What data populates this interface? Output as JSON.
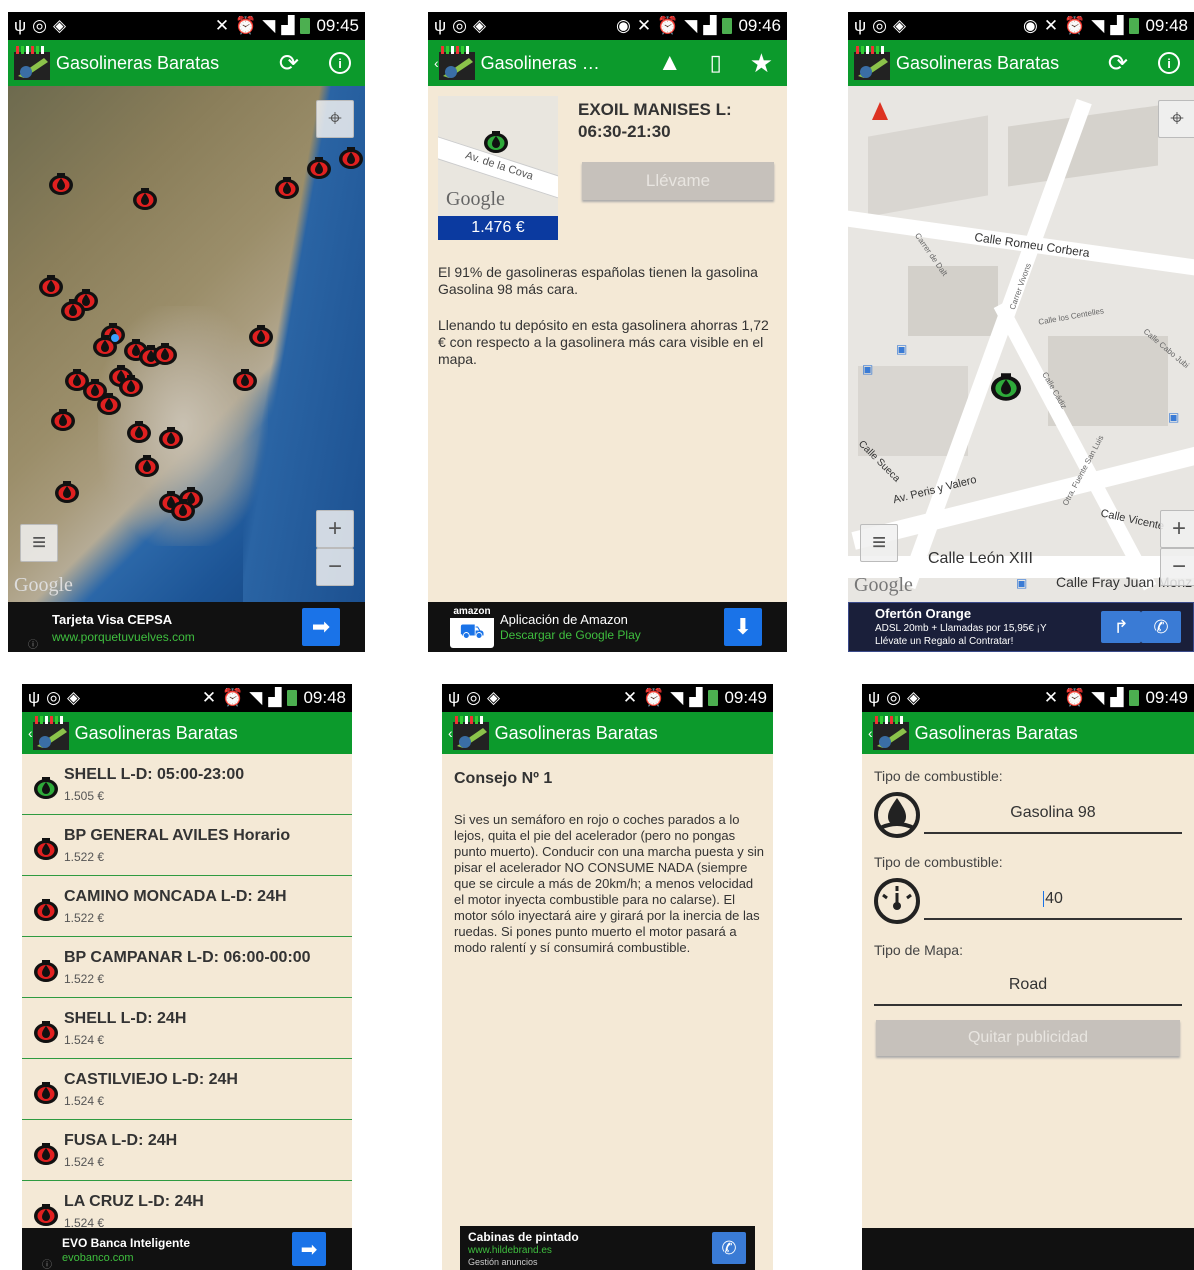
{
  "status": {
    "screen1_time": "09:45",
    "screen2_time": "09:46",
    "screen3_time": "09:48",
    "screen4_time": "09:48",
    "screen5_time": "09:49",
    "screen6_time": "09:49"
  },
  "app": {
    "title": "Gasolineras Baratas",
    "title_truncated": "Gasolineras Ba..."
  },
  "map_screen": {
    "google_label": "Google",
    "ad": {
      "title": "Tarjeta Visa CEPSA",
      "url": "www.porquetuvuelves.com"
    }
  },
  "detail_screen": {
    "station_title": "EXOIL MANISES L:",
    "station_hours": "06:30-21:30",
    "street_label": "Av. de la Cova",
    "google_label": "Google",
    "price": "1.476 €",
    "take_me_button": "Llévame",
    "paragraph1": "El 91% de gasolineras españolas tienen la gasolina Gasolina 98 más cara.",
    "paragraph2": "Llenando tu depósito en esta gasolinera ahorras 1,72 € con respecto a la gasolinera más cara visible en el mapa.",
    "ad": {
      "brand": "amazon",
      "title": "Aplicación de Amazon",
      "sub": "Descargar de Google Play"
    }
  },
  "road_map_screen": {
    "streets": [
      "Calle Romeu Corbera",
      "Calle León XIII",
      "Calle Fray Juan Monz",
      "Av. Peris y Valero",
      "Calle Sueca",
      "Calle Vicente",
      "Calle los Centelles",
      "Calle Cádiz",
      "Otra. Fuente San Luis",
      "Carrer Vivons",
      "Carrer de Dalt",
      "Calle Cabo Jubi"
    ],
    "google_label": "Google",
    "ad": {
      "title": "Ofertón Orange",
      "line1": "ADSL 20mb + Llamadas por 15,95€ ¡Y",
      "line2": "Llévate un Regalo al Contratar!"
    }
  },
  "list_screen": {
    "items": [
      {
        "name": "SHELL L-D: 05:00-23:00",
        "price": "1.505 €",
        "icon_color": "#2eaa3a"
      },
      {
        "name": "BP GENERAL AVILES Horario",
        "price": "1.522 €",
        "icon_color": "#e02020"
      },
      {
        "name": "CAMINO MONCADA L-D: 24H",
        "price": "1.522 €",
        "icon_color": "#e02020"
      },
      {
        "name": "BP CAMPANAR L-D: 06:00-00:00",
        "price": "1.522 €",
        "icon_color": "#e02020"
      },
      {
        "name": "SHELL L-D: 24H",
        "price": "1.524 €",
        "icon_color": "#e02020"
      },
      {
        "name": "CASTILVIEJO L-D: 24H",
        "price": "1.524 €",
        "icon_color": "#e02020"
      },
      {
        "name": "FUSA L-D: 24H",
        "price": "1.524 €",
        "icon_color": "#e02020"
      },
      {
        "name": "LA CRUZ L-D: 24H",
        "price": "1.524 €",
        "icon_color": "#e02020"
      }
    ],
    "ad": {
      "title": "EVO Banca Inteligente",
      "url": "evobanco.com"
    }
  },
  "tip_screen": {
    "heading": "Consejo Nº 1",
    "text": "Si ves un semáforo en rojo o coches parados a lo lejos, quita el pie del acelerador (pero no pongas punto muerto). Conducir con una marcha puesta y sin pisar el acelerador NO CONSUME NADA (siempre que se circule a más de 20km/h; a menos velocidad el motor inyecta combustible para no calarse). El motor sólo inyectará aire y girará por la inercia de las ruedas. Si pones punto muerto el motor pasará a modo ralentí y sí consumirá combustible.",
    "ad": {
      "title": "Cabinas de pintado",
      "url": "www.hildebrand.es",
      "sub": "Gestión anuncios"
    }
  },
  "settings_screen": {
    "fuel_label": "Tipo de combustible:",
    "fuel_value": "Gasolina 98",
    "tank_label": "Tipo de combustible:",
    "tank_value": "40",
    "map_label": "Tipo de Mapa:",
    "map_value": "Road",
    "remove_ads_button": "Quitar publicidad"
  },
  "colors": {
    "actionbar": "#0c9a2c",
    "background": "#f4e9d6",
    "price_box": "#0b3aa0",
    "pin_red": "#e02020",
    "pin_green": "#2eaa3a"
  }
}
